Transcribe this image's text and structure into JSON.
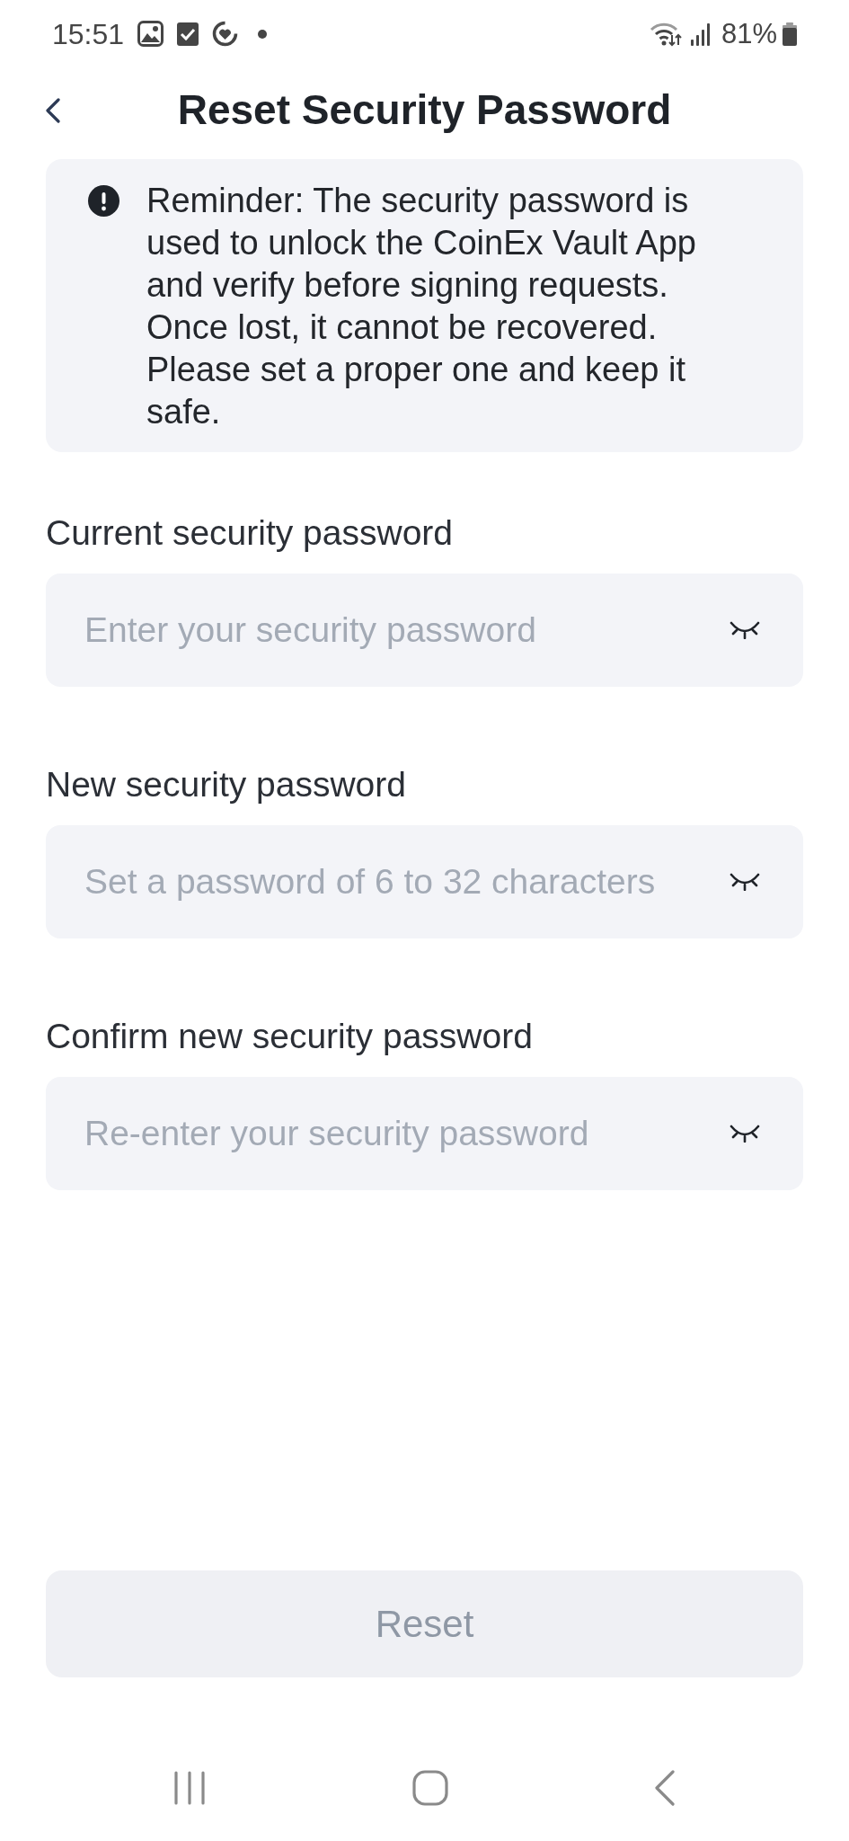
{
  "status_bar": {
    "time": "15:51",
    "battery": "81%"
  },
  "header": {
    "title": "Reset Security Password"
  },
  "reminder": {
    "text": "Reminder: The security password is used to unlock the CoinEx Vault App and verify before signing requests. Once lost, it cannot be recovered. Please set a proper one and keep it safe."
  },
  "fields": [
    {
      "label": "Current security password",
      "placeholder": "Enter your security password",
      "revealed": false
    },
    {
      "label": "New security password",
      "placeholder": "Set a password of 6 to 32 characters",
      "revealed": false
    },
    {
      "label": "Confirm new security password",
      "placeholder": "Re-enter your security password",
      "revealed": false
    }
  ],
  "reset_button": {
    "label": "Reset",
    "disabled": true
  }
}
